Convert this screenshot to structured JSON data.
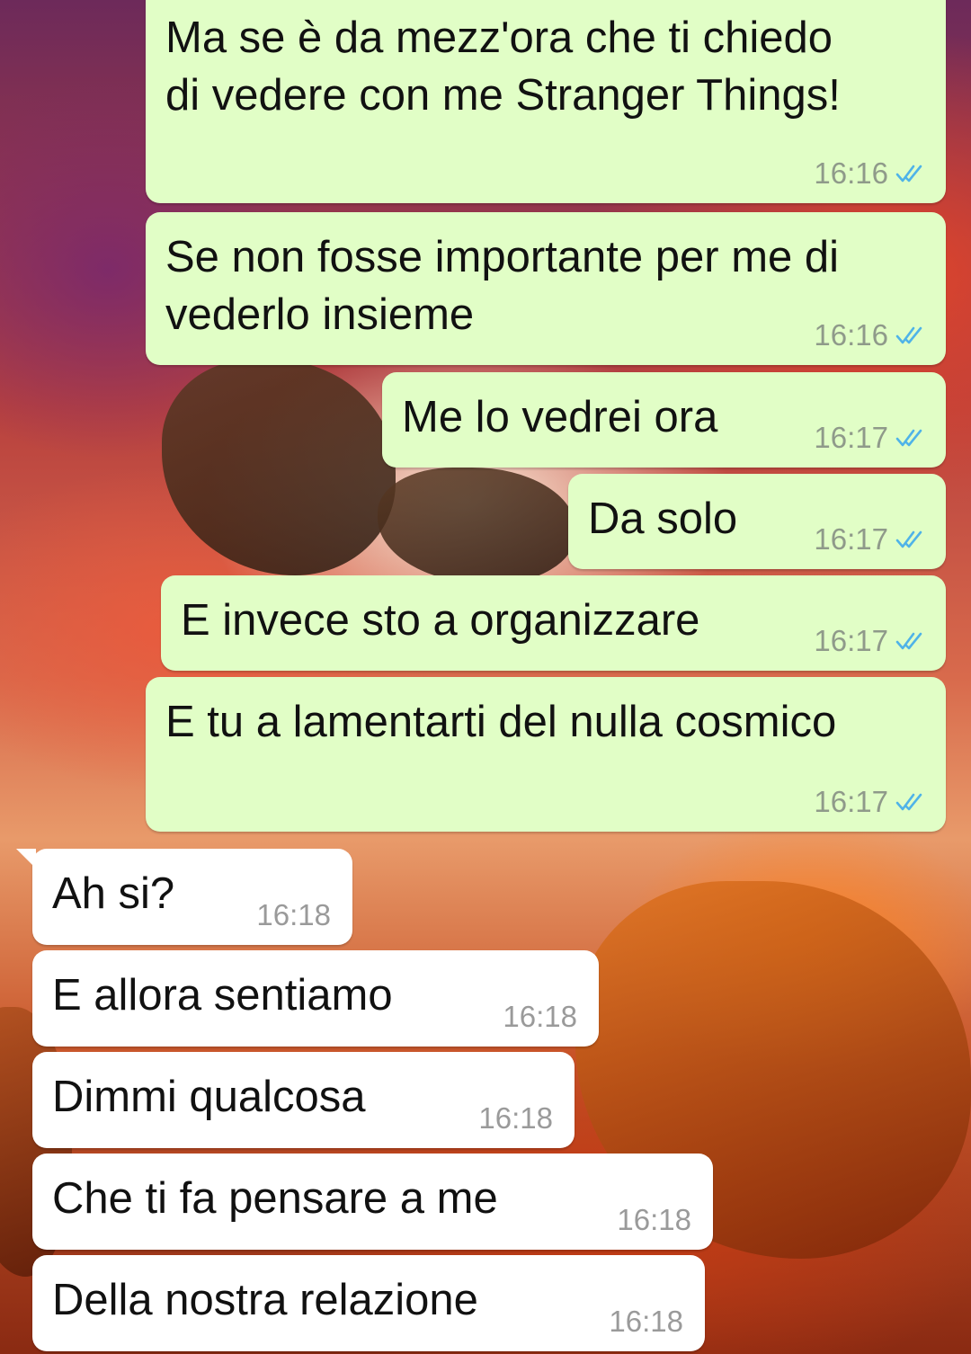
{
  "messages": [
    {
      "direction": "outgoing",
      "text": "Ma se è da mezz'ora che ti chiedo\ndi vedere con me Stranger Things!",
      "time": "16:16",
      "status_icon": "double-check-read-icon"
    },
    {
      "direction": "outgoing",
      "text": "Se non fosse importante per me di\nvederlo insieme",
      "time": "16:16",
      "status_icon": "double-check-read-icon"
    },
    {
      "direction": "outgoing",
      "text": "Me lo vedrei ora",
      "time": "16:17",
      "status_icon": "double-check-read-icon"
    },
    {
      "direction": "outgoing",
      "text": "Da solo",
      "time": "16:17",
      "status_icon": "double-check-read-icon"
    },
    {
      "direction": "outgoing",
      "text": "E invece sto a organizzare",
      "time": "16:17",
      "status_icon": "double-check-read-icon"
    },
    {
      "direction": "outgoing",
      "text": "E tu a lamentarti del nulla cosmico",
      "time": "16:17",
      "status_icon": "double-check-read-icon"
    },
    {
      "direction": "incoming",
      "text": "Ah si?",
      "time": "16:18"
    },
    {
      "direction": "incoming",
      "text": "E allora sentiamo",
      "time": "16:18"
    },
    {
      "direction": "incoming",
      "text": "Dimmi qualcosa",
      "time": "16:18"
    },
    {
      "direction": "incoming",
      "text": "Che ti fa pensare a me",
      "time": "16:18"
    },
    {
      "direction": "incoming",
      "text": "Della nostra relazione",
      "time": "16:18"
    }
  ],
  "colors": {
    "outgoing_bubble": "#e1fec6",
    "incoming_bubble": "#ffffff",
    "read_ticks": "#4fb3e8"
  }
}
